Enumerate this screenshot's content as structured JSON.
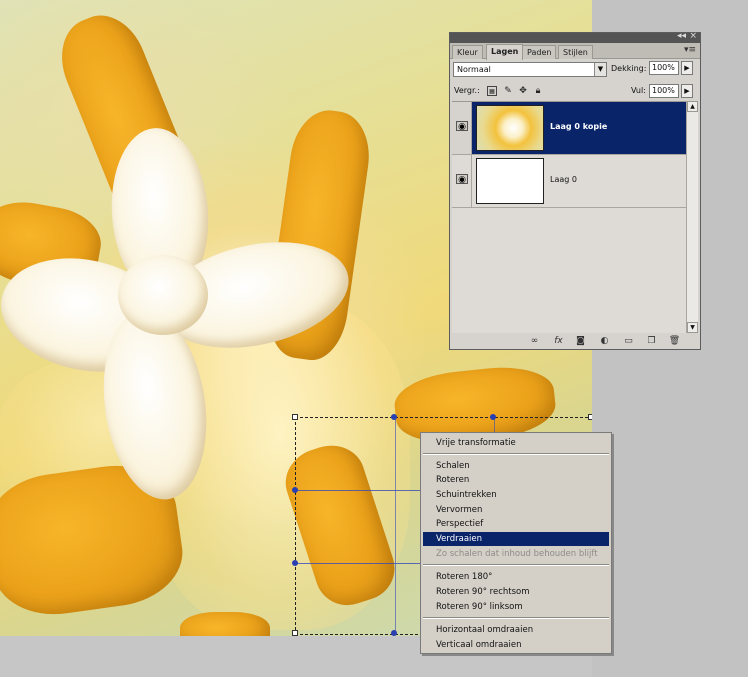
{
  "layers_panel": {
    "tabs": [
      "Kleur",
      "Lagen",
      "Paden",
      "Stijlen"
    ],
    "active_tab": "Lagen",
    "blend_mode": "Normaal",
    "opacity_label": "Dekking:",
    "opacity_value": "100%",
    "lock_label": "Vergr.:",
    "fill_label": "Vul:",
    "fill_value": "100%",
    "layers": [
      {
        "name": "Laag 0 kopie",
        "selected": true,
        "visible": true
      },
      {
        "name": "Laag 0",
        "selected": false,
        "visible": true
      }
    ]
  },
  "context_menu": {
    "items": [
      {
        "label": "Vrije transformatie",
        "state": "normal"
      },
      {
        "label": "Schalen",
        "state": "normal"
      },
      {
        "label": "Roteren",
        "state": "normal"
      },
      {
        "label": "Schuintrekken",
        "state": "normal"
      },
      {
        "label": "Vervormen",
        "state": "normal"
      },
      {
        "label": "Perspectief",
        "state": "normal"
      },
      {
        "label": "Verdraaien",
        "state": "highlight"
      },
      {
        "label": "Zo schalen dat inhoud behouden blijft",
        "state": "disabled"
      },
      {
        "label": "Roteren 180°",
        "state": "normal"
      },
      {
        "label": "Roteren 90° rechtsom",
        "state": "normal"
      },
      {
        "label": "Roteren 90° linksom",
        "state": "normal"
      },
      {
        "label": "Horizontaal omdraaien",
        "state": "normal"
      },
      {
        "label": "Verticaal omdraaien",
        "state": "normal"
      }
    ]
  },
  "colors": {
    "selection": "#0a246a",
    "panel_bg": "#d6d3ce",
    "anther": "#eba21a"
  }
}
